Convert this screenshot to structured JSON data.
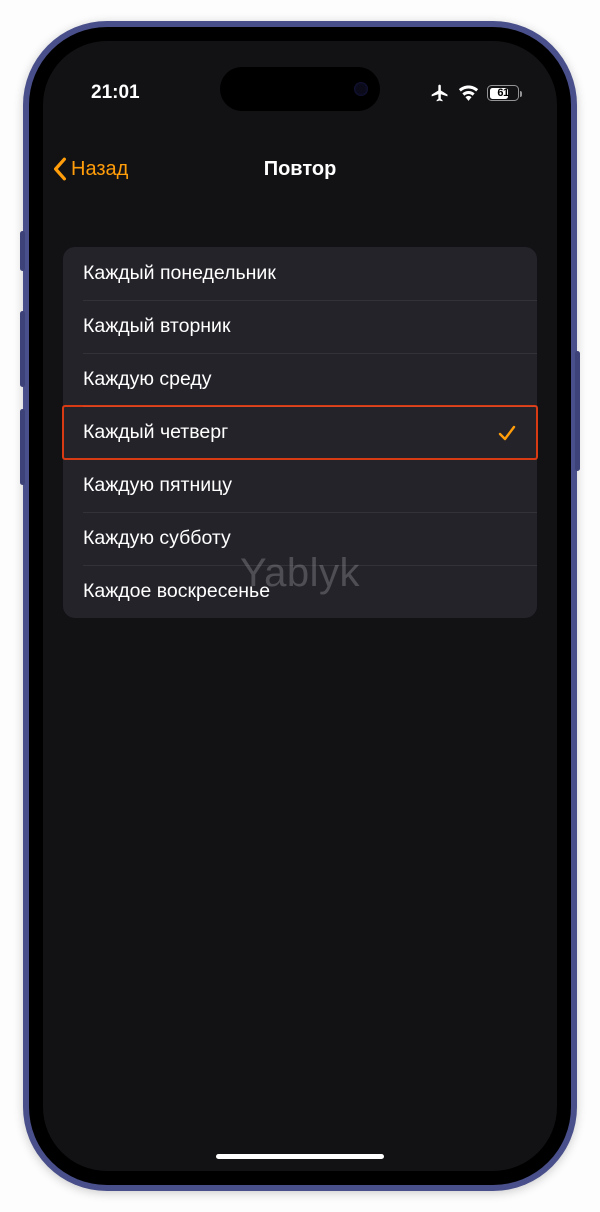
{
  "status": {
    "time": "21:01",
    "battery_pct": "61"
  },
  "nav": {
    "back_label": "Назад",
    "title": "Повтор"
  },
  "days": {
    "items": [
      {
        "label": "Каждый понедельник",
        "selected": false,
        "highlighted": false
      },
      {
        "label": "Каждый вторник",
        "selected": false,
        "highlighted": false
      },
      {
        "label": "Каждую среду",
        "selected": false,
        "highlighted": false
      },
      {
        "label": "Каждый четверг",
        "selected": true,
        "highlighted": true
      },
      {
        "label": "Каждую пятницу",
        "selected": false,
        "highlighted": false
      },
      {
        "label": "Каждую субботу",
        "selected": false,
        "highlighted": false
      },
      {
        "label": "Каждое воскресенье",
        "selected": false,
        "highlighted": false
      }
    ]
  },
  "watermark": "Yablyk",
  "colors": {
    "accent": "#ff9d0a",
    "highlight_border": "#d83a14",
    "screen_bg": "#121114",
    "list_bg": "#24232a"
  }
}
